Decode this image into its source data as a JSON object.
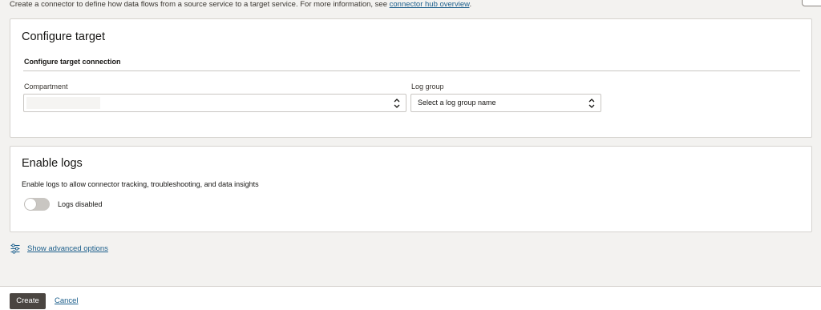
{
  "intro": {
    "text": "Create a connector to define how data flows from a source service to a target service. For more information, see ",
    "link": "connector hub overview",
    "suffix": "."
  },
  "target": {
    "title": "Configure target",
    "subheading": "Configure target connection",
    "compartment": {
      "label": "Compartment",
      "value": ""
    },
    "log_group": {
      "label": "Log group",
      "placeholder": "Select a log group name"
    }
  },
  "logs": {
    "title": "Enable logs",
    "description": "Enable logs to allow connector tracking, troubleshooting, and data insights",
    "toggle_label": "Logs disabled",
    "enabled": false
  },
  "advanced": {
    "label": "Show advanced options",
    "icon": "sliders-icon"
  },
  "footer": {
    "create_label": "Create",
    "cancel_label": "Cancel"
  },
  "colors": {
    "page_bg": "#f3f2f0",
    "link": "#1b5e8b",
    "primary_button": "#4a4541",
    "toggle_off": "#c9c6c2"
  }
}
